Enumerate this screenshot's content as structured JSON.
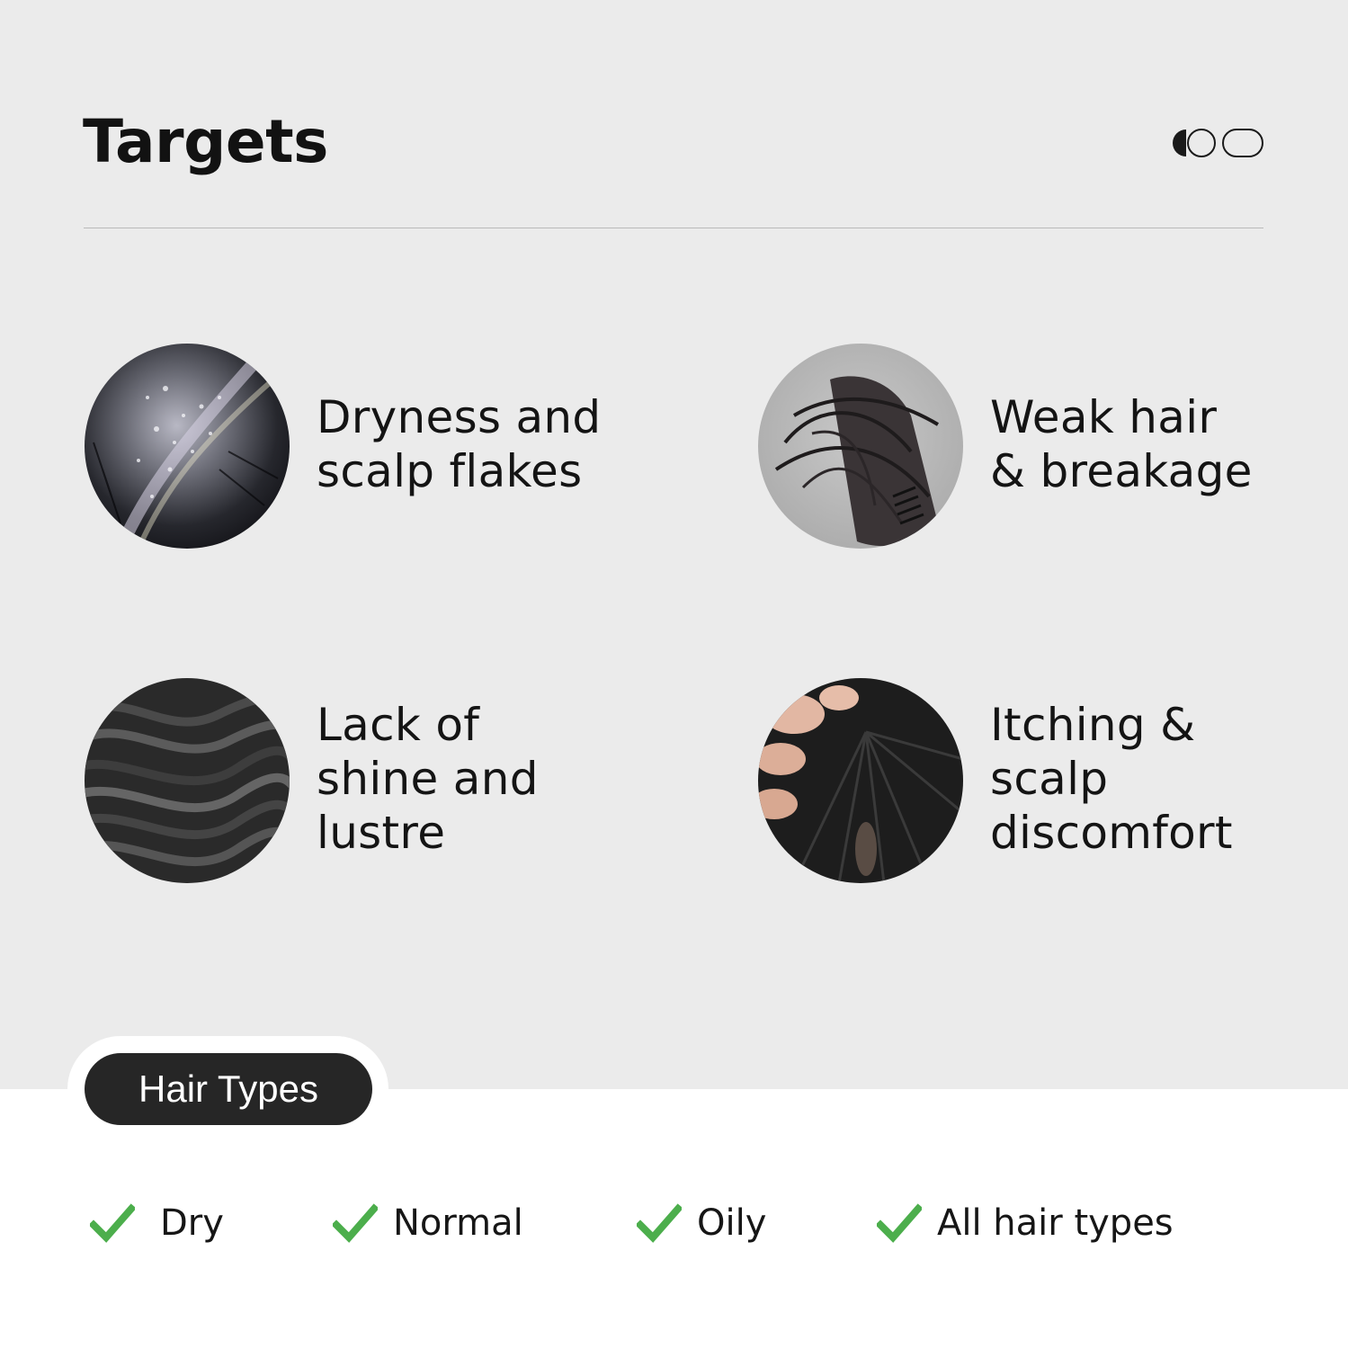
{
  "header": {
    "title": "Targets"
  },
  "targets": [
    {
      "lines": [
        "Dryness and",
        "scalp flakes"
      ],
      "image": "dry-flaky-scalp-photo"
    },
    {
      "lines": [
        "Weak hair",
        "& breakage"
      ],
      "image": "hair-in-comb-photo"
    },
    {
      "lines": [
        "Lack of",
        "shine and",
        "lustre"
      ],
      "image": "dark-wavy-hair-photo"
    },
    {
      "lines": [
        "Itching &",
        "scalp",
        "discomfort"
      ],
      "image": "fingers-scratching-scalp-photo"
    }
  ],
  "hair_types": {
    "badge": "Hair Types",
    "items": [
      "Dry",
      "Normal",
      "Oily",
      "All hair types"
    ],
    "check_color": "#4cae4c"
  },
  "colors": {
    "top_background": "#ebebeb",
    "bottom_background": "#ffffff",
    "badge_background": "#262626",
    "text": "#121212"
  }
}
